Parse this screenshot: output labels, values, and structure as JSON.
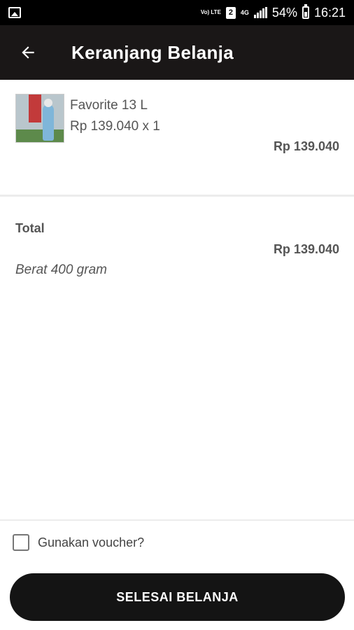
{
  "status_bar": {
    "volte": "Vo) LTE",
    "sim": "2",
    "network": "4G",
    "battery": "54%",
    "time": "16:21"
  },
  "header": {
    "back_icon": "arrow-left-icon",
    "title": "Keranjang Belanja"
  },
  "cart": {
    "items": [
      {
        "name": "Favorite 13 L",
        "price_qty": "Rp 139.040 x 1",
        "subtotal": "Rp 139.040"
      }
    ]
  },
  "summary": {
    "total_label": "Total",
    "total_value": "Rp 139.040",
    "weight": "Berat 400 gram"
  },
  "voucher": {
    "label": "Gunakan voucher?",
    "checked": false
  },
  "checkout": {
    "button_label": "SELESAI BELANJA"
  },
  "colors": {
    "app_bar": "#1a1717",
    "button": "#141414",
    "text": "#555555"
  }
}
